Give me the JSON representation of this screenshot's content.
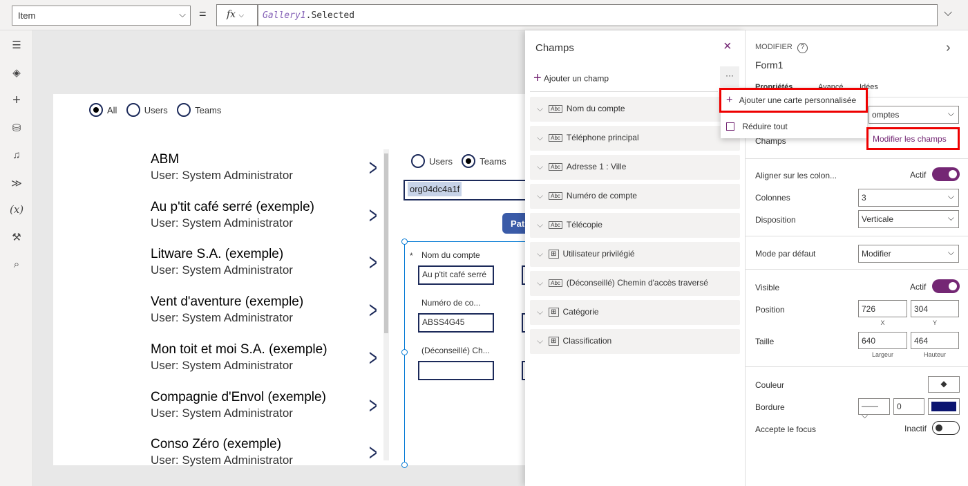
{
  "formula_bar": {
    "property": "Item",
    "equals": "=",
    "fx": "fx",
    "formula_ctrl": "Gallery1",
    "formula_rest": ".Selected"
  },
  "rail": {
    "icons": [
      "hamburger-icon",
      "layers-icon",
      "plus-icon",
      "database-icon",
      "media-icon",
      "power-automate-icon",
      "variables-icon",
      "tools-icon",
      "search-icon"
    ]
  },
  "screen": {
    "radios": [
      {
        "label": "All",
        "selected": true
      },
      {
        "label": "Users",
        "selected": false
      },
      {
        "label": "Teams",
        "selected": false
      }
    ],
    "gallery": [
      {
        "title": "ABM",
        "subtitle": "User: System Administrator"
      },
      {
        "title": "Au p'tit café serré (exemple)",
        "subtitle": "User: System Administrator"
      },
      {
        "title": "Litware S.A. (exemple)",
        "subtitle": "User: System Administrator"
      },
      {
        "title": "Vent d'aventure (exemple)",
        "subtitle": "User: System Administrator"
      },
      {
        "title": "Mon toit et moi S.A. (exemple)",
        "subtitle": "User: System Administrator"
      },
      {
        "title": "Compagnie d'Envol (exemple)",
        "subtitle": "User: System Administrator"
      },
      {
        "title": "Conso Zéro (exemple)",
        "subtitle": "User: System Administrator"
      }
    ],
    "radios2": [
      {
        "label": "Users",
        "selected": false
      },
      {
        "label": "Teams",
        "selected": true
      }
    ],
    "text_input": "org04dc4a1f",
    "button_label": "Pat",
    "form": {
      "required_mark": "*",
      "label1": "Nom du compte",
      "value1": "Au p'tit café serré",
      "label2": "Numéro de co...",
      "value2": "ABSS4G45",
      "label3": "(Déconseillé) Ch...",
      "value3": ""
    }
  },
  "fields_panel": {
    "title": "Champs",
    "add_field": "Ajouter un champ",
    "more": "···",
    "fields": [
      {
        "label": "Nom du compte",
        "type": "Abc"
      },
      {
        "label": "Téléphone principal",
        "type": "Abc"
      },
      {
        "label": "Adresse 1 : Ville",
        "type": "Abc"
      },
      {
        "label": "Numéro de compte",
        "type": "Abc"
      },
      {
        "label": "Télécopie",
        "type": "Abc"
      },
      {
        "label": "Utilisateur privilégié",
        "type": "grid"
      },
      {
        "label": "(Déconseillé) Chemin d'accès traversé",
        "type": "Abc"
      },
      {
        "label": "Catégorie",
        "type": "grid"
      },
      {
        "label": "Classification",
        "type": "grid"
      }
    ],
    "menu": {
      "add_custom_card": "Ajouter une carte personnalisée",
      "collapse_all": "Réduire tout"
    }
  },
  "properties_panel": {
    "header": "MODIFIER",
    "control_name": "Form1",
    "tabs": [
      "Propriétés",
      "Avancé",
      "Idées"
    ],
    "data_source": "Comptes",
    "data_source_visible": "omptes",
    "fields_label": "Champs",
    "edit_fields": "Modifier les champs",
    "snap_label": "Aligner sur les colon...",
    "snap_state": "Actif",
    "columns_label": "Colonnes",
    "columns_value": "3",
    "layout_label": "Disposition",
    "layout_value": "Verticale",
    "default_mode_label": "Mode par défaut",
    "default_mode_value": "Modifier",
    "visible_label": "Visible",
    "visible_state": "Actif",
    "position_label": "Position",
    "x": "726",
    "y": "304",
    "x_label": "X",
    "y_label": "Y",
    "size_label": "Taille",
    "width": "640",
    "height": "464",
    "width_label": "Largeur",
    "height_label": "Hauteur",
    "color_label": "Couleur",
    "border_label": "Bordure",
    "border_width": "0",
    "border_color": "#0b1470",
    "focus_label": "Accepte le focus",
    "focus_state": "Inactif",
    "accent": "#742774",
    "highlight": "#e00000"
  }
}
